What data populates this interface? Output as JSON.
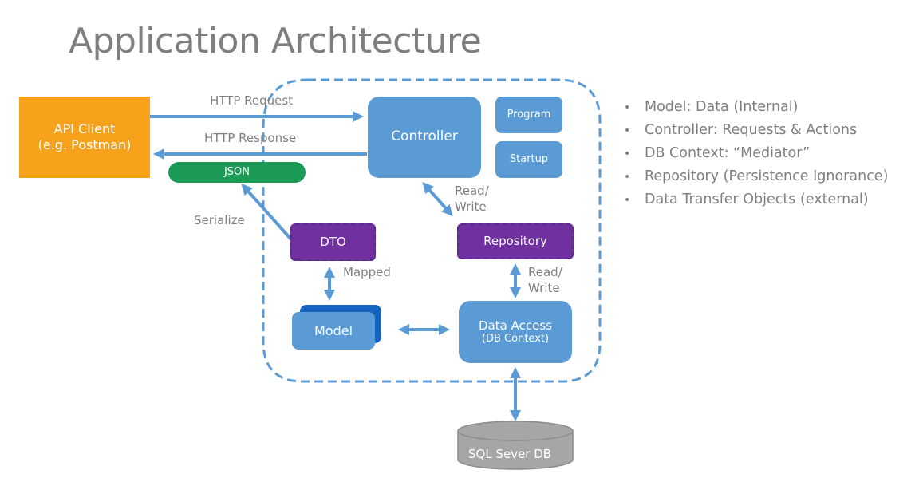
{
  "title": "Application Architecture",
  "nodes": {
    "api_client": {
      "line1": "API Client",
      "line2": "(e.g. Postman)"
    },
    "controller": "Controller",
    "program": "Program",
    "startup": "Startup",
    "json": "JSON",
    "dto": "DTO",
    "repository": "Repository",
    "model": "Model",
    "data_access": {
      "line1": "Data Access",
      "line2": "(DB Context)"
    },
    "database": "SQL Sever DB"
  },
  "edge_labels": {
    "http_request": "HTTP Request",
    "http_response": "HTTP Response",
    "serialize": "Serialize",
    "mapped": "Mapped",
    "controller_repo": {
      "line1": "Read/",
      "line2": "Write"
    },
    "repo_data": {
      "line1": "Read/",
      "line2": "Write"
    }
  },
  "bullets": [
    "Model: Data (Internal)",
    "Controller: Requests & Actions",
    "DB Context: “Mediator”",
    "Repository (Persistence Ignorance)",
    "Data Transfer Objects (external)"
  ],
  "colors": {
    "node_blue": "#5b9bd5",
    "client_orange": "#f8a21c",
    "json_green": "#1a9a55",
    "dto_purple": "#7030a0",
    "db_gray": "#a6a6a6",
    "text_gray": "#7f7f7f"
  }
}
